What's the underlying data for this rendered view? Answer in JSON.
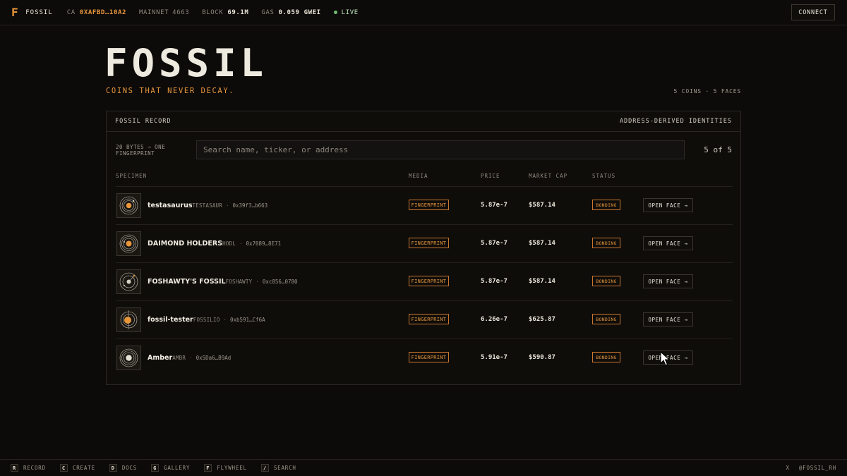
{
  "topbar": {
    "logo": "F",
    "brand": "FOSSIL",
    "ca_label": "CA",
    "ca_value": "0XAFBD…10A2",
    "network_label": "MAINNET",
    "network_value": "4663",
    "block_label": "BLOCK",
    "block_value": "69.1M",
    "gas_label": "GAS",
    "gas_value": "0.059 GWEI",
    "live": "LIVE",
    "connect": "CONNECT"
  },
  "hero": {
    "title": "FOSSIL",
    "tagline": "COINS THAT NEVER DECAY.",
    "counts": "5 COINS · 5 FACES"
  },
  "panel": {
    "title": "FOSSIL RECORD",
    "subtitle": "ADDRESS-DERIVED IDENTITIES",
    "note": "20 BYTES → ONE FINGERPRINT",
    "search_placeholder": "Search name, ticker, or address",
    "result_count": "5 of 5",
    "columns": {
      "specimen": "SPECIMEN",
      "media": "MEDIA",
      "price": "PRICE",
      "market_cap": "MARKET CAP",
      "status": "STATUS"
    },
    "rows": [
      {
        "name": "testasaurus",
        "ticker": "TESTASAUR",
        "addr": "0x39f3…b663",
        "media": "FINGERPRINT",
        "price": "5.87e-7",
        "mcap": "$587.14",
        "status": "BONDING",
        "action": "OPEN FACE →"
      },
      {
        "name": "DAIMOND HOLDERS",
        "ticker": "HODL",
        "addr": "0x7089…8E71",
        "media": "FINGERPRINT",
        "price": "5.87e-7",
        "mcap": "$587.14",
        "status": "BONDING",
        "action": "OPEN FACE →"
      },
      {
        "name": "FOSHAWTY'S FOSSIL",
        "ticker": "FOSHAWTY",
        "addr": "0xc856…0780",
        "media": "FINGERPRINT",
        "price": "5.87e-7",
        "mcap": "$587.14",
        "status": "BONDING",
        "action": "OPEN FACE →"
      },
      {
        "name": "fossil-tester",
        "ticker": "FOSSILIO",
        "addr": "0xb591…Cf6A",
        "media": "FINGERPRINT",
        "price": "6.26e-7",
        "mcap": "$625.87",
        "status": "BONDING",
        "action": "OPEN FACE →"
      },
      {
        "name": "Amber",
        "ticker": "AMBR",
        "addr": "0x5Da6…B9Ad",
        "media": "FINGERPRINT",
        "price": "5.91e-7",
        "mcap": "$590.87",
        "status": "BONDING",
        "action": "OPEN FACE →"
      }
    ]
  },
  "bottombar": {
    "shortcuts": [
      {
        "key": "R",
        "label": "RECORD"
      },
      {
        "key": "C",
        "label": "CREATE"
      },
      {
        "key": "D",
        "label": "DOCS"
      },
      {
        "key": "G",
        "label": "GALLERY"
      },
      {
        "key": "F",
        "label": "FLYWHEEL"
      },
      {
        "key": "/",
        "label": "SEARCH"
      }
    ],
    "x_label": "X",
    "handle": "@FOSSIL_RH"
  },
  "colors": {
    "accent": "#e8963c",
    "live": "#6fbf73",
    "background": "#0d0b09"
  }
}
